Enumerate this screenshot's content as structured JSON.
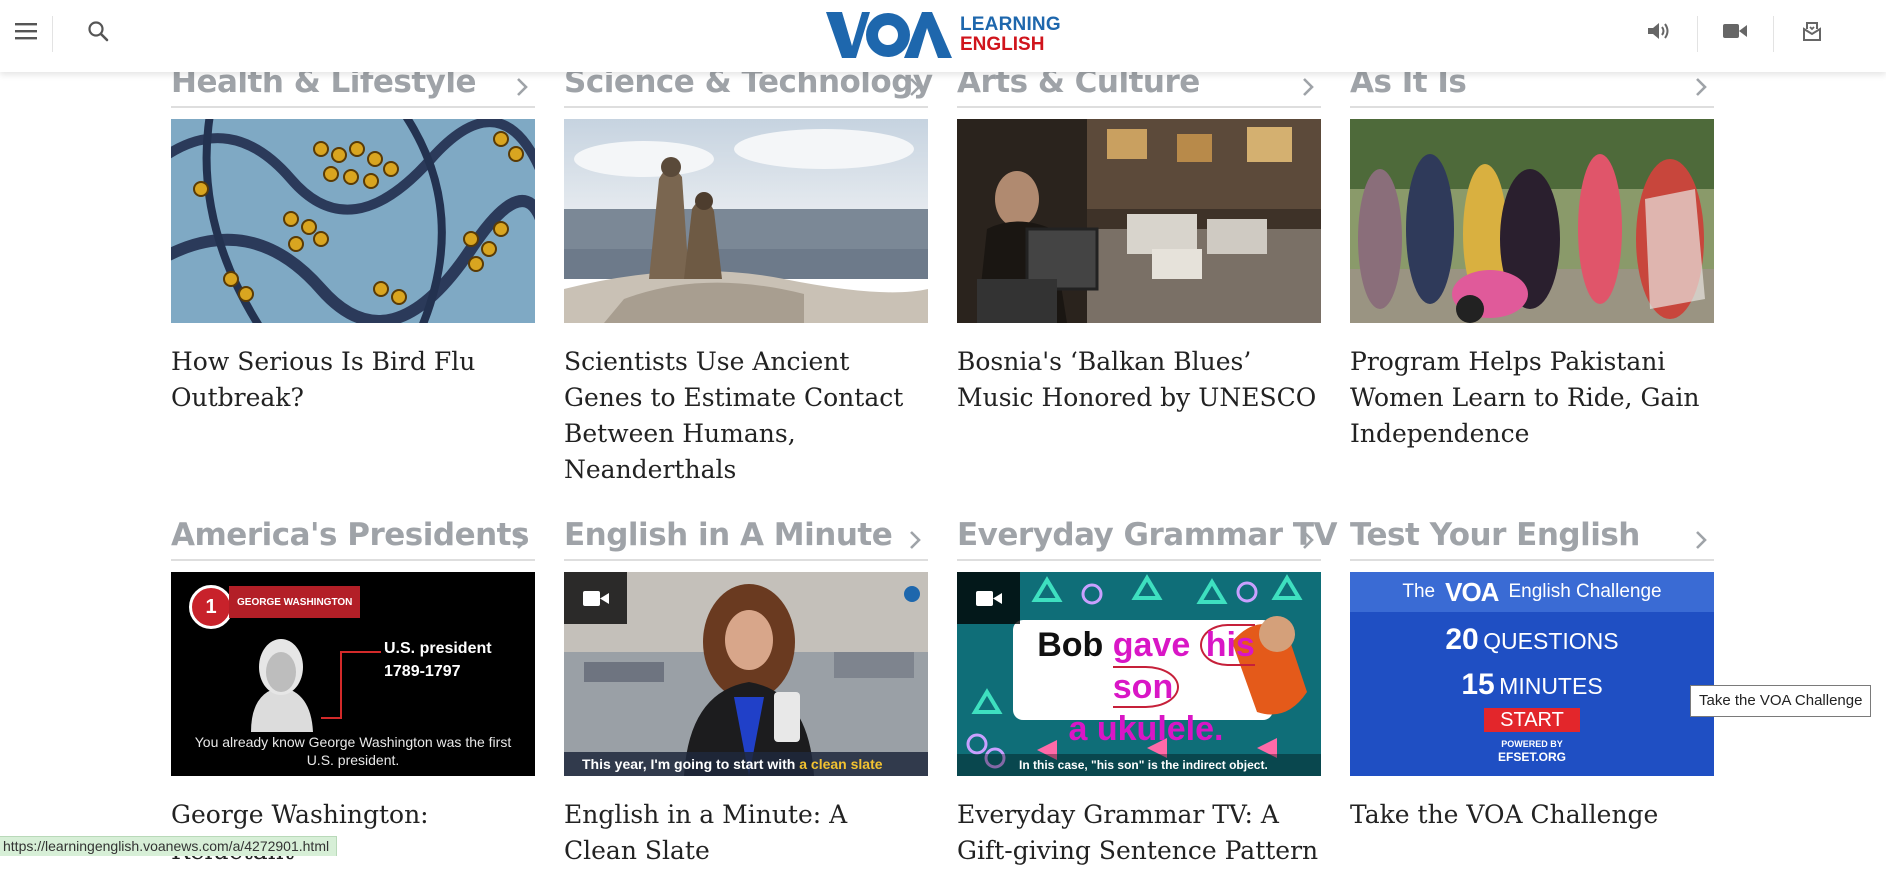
{
  "header": {
    "logo_mark": "VOA",
    "logo_line1": "LEARNING",
    "logo_line2": "ENGLISH",
    "icons": [
      "menu-icon",
      "search-icon",
      "speaker-icon",
      "video-camera-icon",
      "podcast-icon"
    ]
  },
  "sections_row1": [
    {
      "title": "Health & Lifestyle",
      "headline": "How Serious Is Bird Flu Outbreak?"
    },
    {
      "title": "Science & Technology",
      "headline": "Scientists Use Ancient Genes to Estimate Contact Between Humans, Neanderthals"
    },
    {
      "title": "Arts & Culture",
      "headline": "Bosnia's ‘Balkan Blues’ Music Honored by UNESCO"
    },
    {
      "title": "As It Is",
      "headline": "Program Helps Pakistani Women Learn to Ride, Gain Independence"
    }
  ],
  "sections_row2": [
    {
      "title": "America's Presidents",
      "headline": "George Washington: Reluctant"
    },
    {
      "title": "English in A Minute",
      "headline": "English in a Minute: A Clean Slate"
    },
    {
      "title": "Everyday Grammar TV",
      "headline": "Everyday Grammar TV: A Gift-giving Sentence Pattern"
    },
    {
      "title": "Test Your English",
      "headline": "Take the VOA Challenge"
    }
  ],
  "thumb_texts": {
    "washington_badge_num": "1",
    "washington_badge": "GEORGE WASHINGTON",
    "washington_role": "U.S. president",
    "washington_years": "1789-1797",
    "washington_caption": "You already know George Washington was the first U.S. president.",
    "minute_caption_pre": "This year, I'm going to start with ",
    "minute_caption_hl": "a clean slate",
    "grammar_w1": "Bob",
    "grammar_w2": "gave",
    "grammar_w3": "his son",
    "grammar_w4": "a ukulele.",
    "grammar_caption": "In this case, \"his son\" is the indirect object.",
    "challenge_the": "The",
    "challenge_logo": "VOA",
    "challenge_title": "English Challenge",
    "challenge_q_num": "20",
    "challenge_q": "QUESTIONS",
    "challenge_m_num": "15",
    "challenge_m": "MINUTES",
    "challenge_start": "START",
    "challenge_powered": "POWERED BY",
    "challenge_efset": "EFSET.ORG"
  },
  "tooltip": "Take the VOA Challenge",
  "status_url": "https://learningenglish.voanews.com/a/4272901.html",
  "colors": {
    "brand_blue": "#1e67ad",
    "brand_red": "#d0141c",
    "section_title": "#9fa3a8",
    "challenge_blue": "#1f4fc3"
  }
}
